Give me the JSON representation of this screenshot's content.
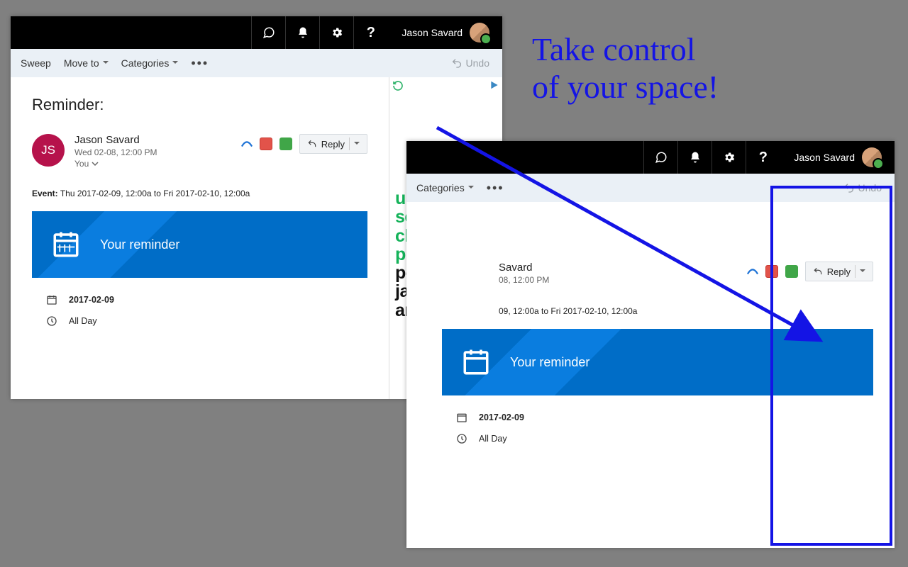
{
  "promo": {
    "headline_l1": "Take control",
    "headline_l2": "of your space!"
  },
  "header": {
    "user_name": "Jason Savard"
  },
  "toolbar": {
    "sweep": "Sweep",
    "move_to": "Move to",
    "categories": "Categories",
    "undo": "Undo"
  },
  "message": {
    "subject": "Reminder:",
    "sender_initials": "JS",
    "sender_name": "Jason Savard",
    "date": "Wed 02-08, 12:00 PM",
    "to_you": "You",
    "reply_label": "Reply",
    "event_label": "Event:",
    "event_text": "Thu 2017-02-09, 12:00a to Fri 2017-02-10, 12:00a"
  },
  "reminder": {
    "title": "Your reminder",
    "date": "2017-02-09",
    "time": "All Day"
  },
  "ad": {
    "line1": "un",
    "line2": "service",
    "line3": "client",
    "line4": "primé",
    "line5": "pour ne",
    "line6": "jamais",
    "line7": "arrêter."
  },
  "after_toolbar": {
    "categories": "Categories",
    "undo": "Undo"
  },
  "after_message": {
    "sender_fragment": "Savard",
    "date_fragment": "08, 12:00 PM",
    "reply_label": "Reply",
    "event_fragment": "09, 12:00a to Fri 2017-02-10, 12:00a"
  }
}
